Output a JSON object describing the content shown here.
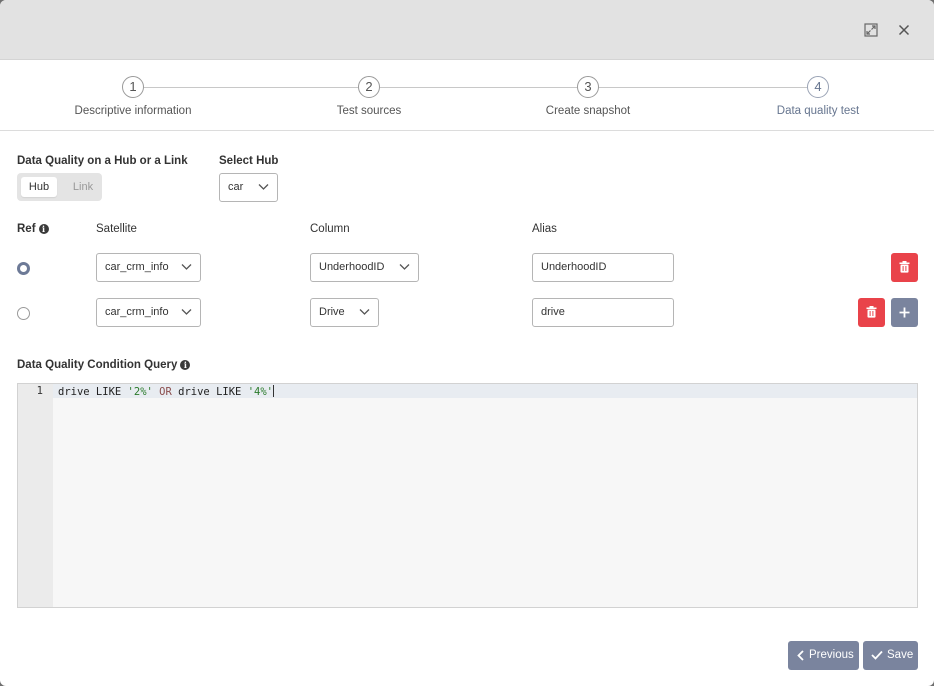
{
  "window": {
    "expand_icon": "expand-icon",
    "close_icon": "close-icon"
  },
  "steps": [
    {
      "number": "1",
      "label": "Descriptive information"
    },
    {
      "number": "2",
      "label": "Test sources"
    },
    {
      "number": "3",
      "label": "Create snapshot"
    },
    {
      "number": "4",
      "label": "Data quality test",
      "active": true
    }
  ],
  "hub_or_link": {
    "label": "Data Quality on a Hub or a Link",
    "options": [
      "Hub",
      "Link"
    ],
    "selected": "Hub"
  },
  "select_hub": {
    "label": "Select Hub",
    "value": "car"
  },
  "table": {
    "headers": {
      "ref": "Ref",
      "satellite": "Satellite",
      "column": "Column",
      "alias": "Alias"
    },
    "rows": [
      {
        "ref_selected": true,
        "satellite": "car_crm_info",
        "column": "UnderhoodID",
        "alias": "UnderhoodID"
      },
      {
        "ref_selected": false,
        "satellite": "car_crm_info",
        "column": "Drive",
        "alias": "drive"
      }
    ]
  },
  "query": {
    "label": "Data Quality Condition Query",
    "line_number": "1",
    "tokens": [
      "drive LIKE ",
      "'2%'",
      " OR ",
      "drive LIKE ",
      "'4%'"
    ]
  },
  "footer": {
    "previous_label": "Previous",
    "save_label": "Save"
  },
  "colors": {
    "accent": "#7a849e",
    "danger": "#e9434a",
    "titlebar": "#e2e2e2"
  }
}
